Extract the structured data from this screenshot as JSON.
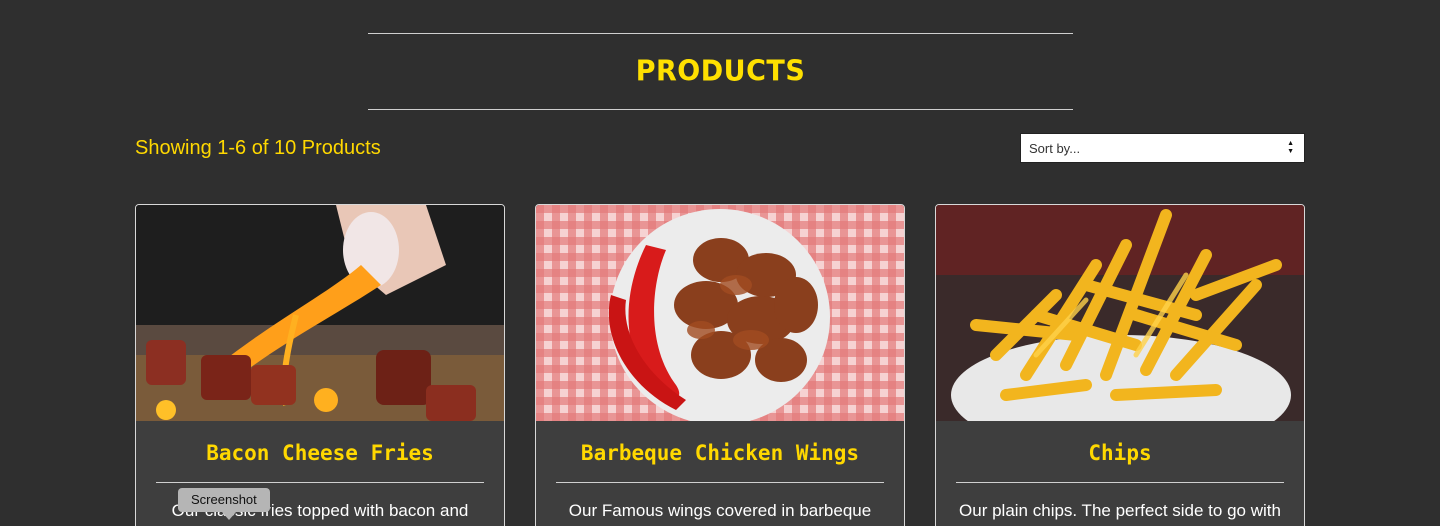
{
  "header": {
    "title": "PRODUCTS"
  },
  "toolbar": {
    "showing_text": "Showing 1-6 of 10 Products",
    "sort_placeholder": "Sort by..."
  },
  "products": [
    {
      "name": "Bacon Cheese Fries",
      "description": "Our classic fries topped with bacon and",
      "image": "bacon-cheese-fries-photo"
    },
    {
      "name": "Barbeque Chicken Wings",
      "description": "Our Famous wings covered in barbeque",
      "image": "bbq-chicken-wings-photo"
    },
    {
      "name": "Chips",
      "description": "Our plain chips. The perfect side to go with",
      "image": "chips-photo"
    }
  ],
  "tooltip": {
    "label": "Screenshot"
  },
  "colors": {
    "background": "#2f2f2f",
    "accent": "#ffd800",
    "card_background": "#3e3e3e"
  }
}
